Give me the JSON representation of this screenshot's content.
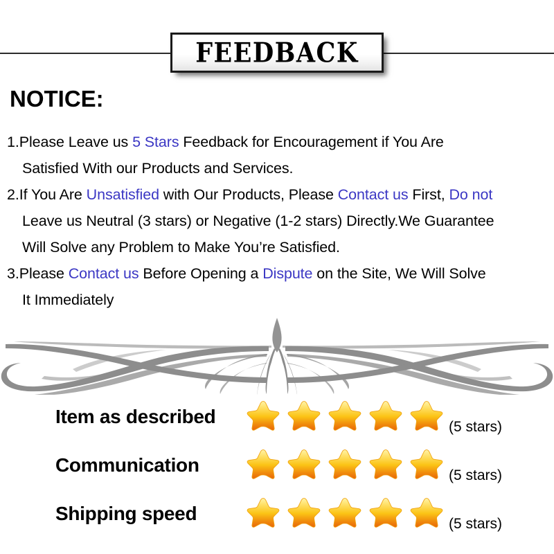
{
  "header": {
    "title": "FEEDBACK"
  },
  "notice": {
    "heading": "NOTICE:",
    "lines": [
      {
        "segments": [
          {
            "text": "1.Please Leave us  ",
            "highlight": false
          },
          {
            "text": "5 Stars",
            "highlight": true
          },
          {
            "text": "  Feedback for  Encouragement  if You Are",
            "highlight": false
          }
        ],
        "indent": false
      },
      {
        "segments": [
          {
            "text": "Satisfied With our Products and Services.",
            "highlight": false
          }
        ],
        "indent": true
      },
      {
        "segments": [
          {
            "text": "2.If You Are ",
            "highlight": false
          },
          {
            "text": "Unsatisfied",
            "highlight": true
          },
          {
            "text": " with Our Products, Please ",
            "highlight": false
          },
          {
            "text": "Contact us",
            "highlight": true
          },
          {
            "text": " First, ",
            "highlight": false
          },
          {
            "text": "Do not",
            "highlight": true
          }
        ],
        "indent": false
      },
      {
        "segments": [
          {
            "text": "Leave us Neutral (3 stars) or Negative (1-2 stars) Directly.We Guarantee",
            "highlight": false
          }
        ],
        "indent": true
      },
      {
        "segments": [
          {
            "text": "Will Solve any Problem to Make You’re  Satisfied.",
            "highlight": false
          }
        ],
        "indent": true
      },
      {
        "segments": [
          {
            "text": "3.Please ",
            "highlight": false
          },
          {
            "text": "Contact us",
            "highlight": true
          },
          {
            "text": " Before Opening a ",
            "highlight": false
          },
          {
            "text": "Dispute",
            "highlight": true
          },
          {
            "text": " on the Site, We Will Solve",
            "highlight": false
          }
        ],
        "indent": false
      },
      {
        "segments": [
          {
            "text": "It Immediately",
            "highlight": false
          }
        ],
        "indent": true
      }
    ]
  },
  "ratings": {
    "rows": [
      {
        "label": "Item as described",
        "stars": 5,
        "note": "(5 stars)"
      },
      {
        "label": "Communication",
        "stars": 5,
        "note": "(5 stars)"
      },
      {
        "label": "Shipping speed",
        "stars": 5,
        "note": "(5 stars)"
      }
    ]
  },
  "colors": {
    "highlight_blue": "#3b37c4",
    "star_top": "#ffe98a",
    "star_mid": "#f7c12b",
    "star_bottom": "#ef7f12",
    "flourish_gray": "#8d8d8d",
    "rule_black": "#2b2b2b"
  }
}
